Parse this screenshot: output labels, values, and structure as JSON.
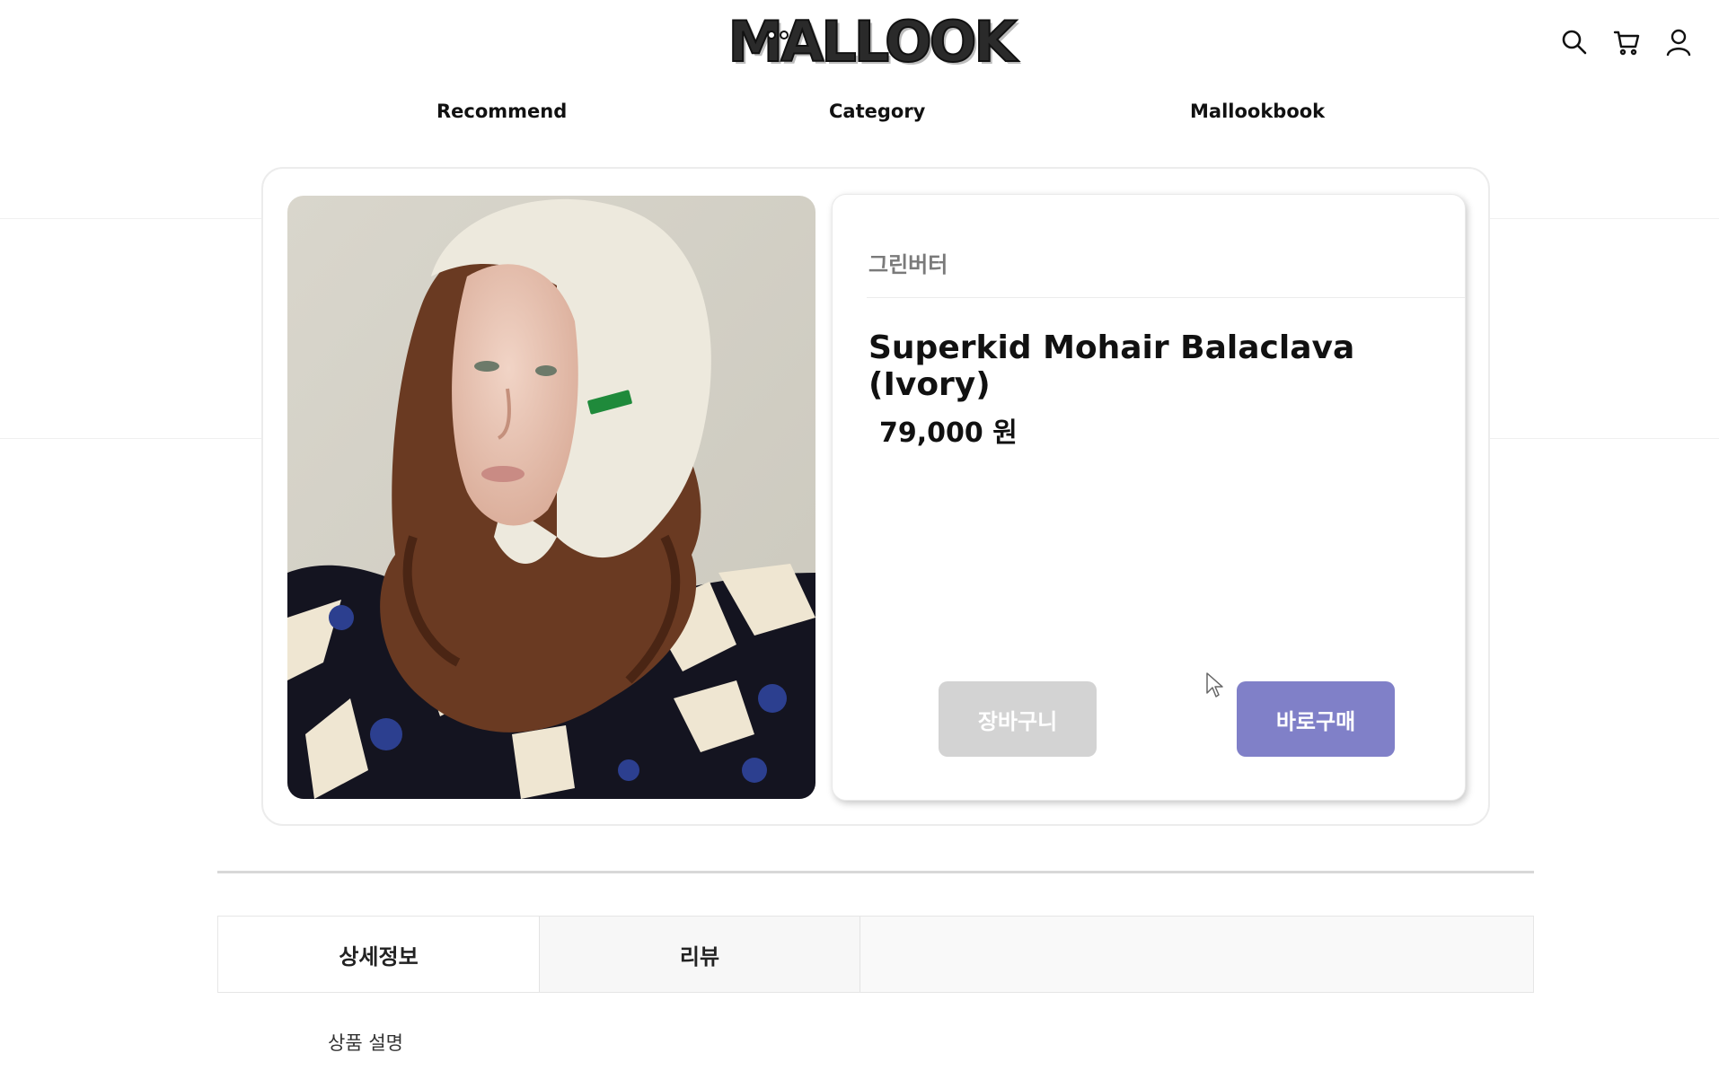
{
  "header": {
    "logo_text": "MALLOOK",
    "icons": [
      "search-icon",
      "cart-icon",
      "user-icon"
    ]
  },
  "nav": {
    "recommend": "Recommend",
    "category": "Category",
    "mallookbook": "Mallookbook"
  },
  "product": {
    "brand": "그린버터",
    "title": "Superkid Mohair Balaclava (Ivory)",
    "price": "79,000 원",
    "cart_button": "장바구니",
    "buy_button": "바로구매"
  },
  "tabs": {
    "detail": "상세정보",
    "review": "리뷰"
  },
  "description": {
    "label": "상품 설명"
  },
  "colors": {
    "buy_button": "#8080c8",
    "cart_button": "#d3d3d3",
    "brand_text": "#7a7a7a"
  }
}
